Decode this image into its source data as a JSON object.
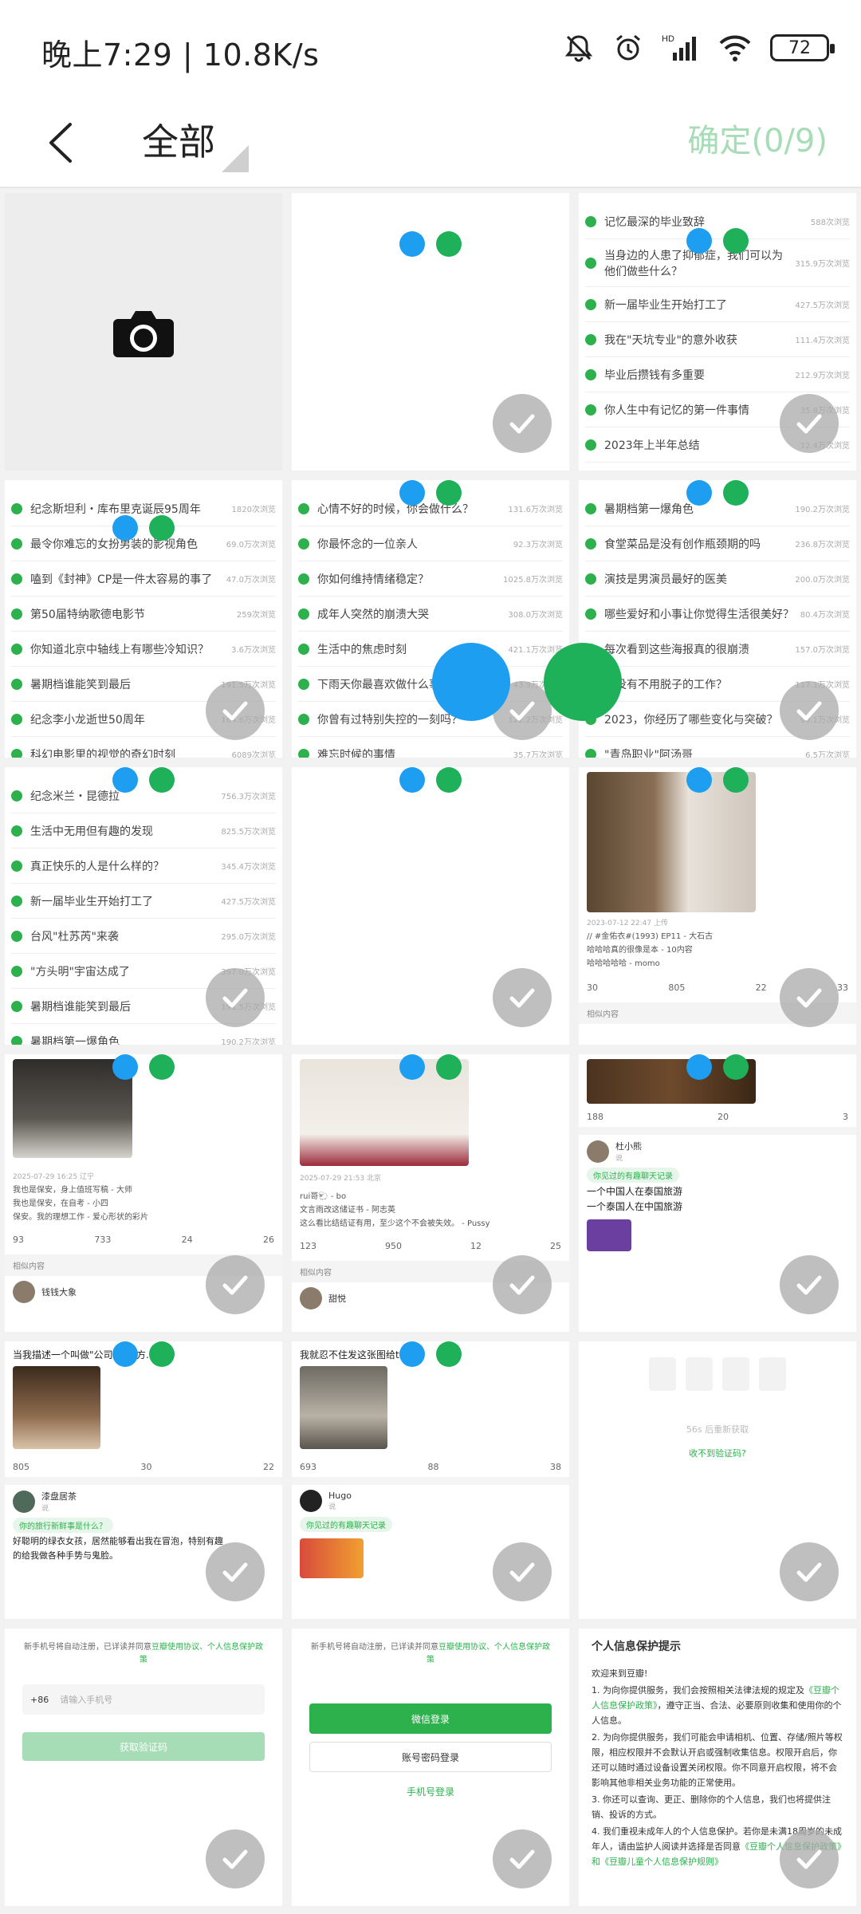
{
  "status": {
    "time": "晚上7:29 | 10.8K/s",
    "battery": "72"
  },
  "header": {
    "title": "全部",
    "confirm": "确定(0/9)"
  },
  "colors": {
    "accent": "#2cb14d",
    "accent_light": "#a6dcb6",
    "dot_blue": "#1e9ef0",
    "dot_green": "#1fb05a"
  },
  "cell1_list": [
    {
      "t": "记忆最深的毕业致辞",
      "n": "588次浏览"
    },
    {
      "t": "当身边的人患了抑郁症，我们可以为他们做些什么？",
      "n": "315.9万次浏览"
    },
    {
      "t": "新一届毕业生开始打工了",
      "n": "427.5万次浏览"
    },
    {
      "t": "我在\"天坑专业\"的意外收获",
      "n": "111.4万次浏览"
    },
    {
      "t": "毕业后攒钱有多重要",
      "n": "212.9万次浏览"
    },
    {
      "t": "你人生中有记忆的第一件事情",
      "n": "35.8万次浏览"
    },
    {
      "t": "2023年上半年总结",
      "n": "12.4万次浏览"
    }
  ],
  "cell3_list": [
    {
      "t": "纪念斯坦利・库布里克诞辰95周年",
      "n": "1820次浏览"
    },
    {
      "t": "最令你难忘的女扮男装的影视角色",
      "n": "69.0万次浏览"
    },
    {
      "t": "嗑到《封神》CP是一件太容易的事了",
      "n": "47.0万次浏览"
    },
    {
      "t": "第50届特纳歌德电影节",
      "n": "259次浏览"
    },
    {
      "t": "你知道北京中轴线上有哪些冷知识？",
      "n": "3.6万次浏览"
    },
    {
      "t": "暑期档谁能笑到最后",
      "n": "191.5万次浏览"
    },
    {
      "t": "纪念李小龙逝世50周年",
      "n": "164.6万次浏览"
    },
    {
      "t": "科幻电影里的视觉的奇幻时刻",
      "n": "6089次浏览"
    }
  ],
  "cell4_list": [
    {
      "t": "心情不好的时候，你会做什么？",
      "n": "131.6万次浏览"
    },
    {
      "t": "你最怀念的一位亲人",
      "n": "92.3万次浏览"
    },
    {
      "t": "你如何维持情绪稳定？",
      "n": "1025.8万次浏览"
    },
    {
      "t": "成年人突然的崩溃大哭",
      "n": "308.0万次浏览"
    },
    {
      "t": "生活中的焦虑时刻",
      "n": "421.1万次浏览"
    },
    {
      "t": "下雨天你最喜欢做什么事",
      "n": "43.9万次浏览"
    },
    {
      "t": "你曾有过特别失控的一刻吗？",
      "n": "122.2万次浏览"
    },
    {
      "t": "难忘时候的事情",
      "n": "35.7万次浏览"
    }
  ],
  "cell5_list": [
    {
      "t": "暑期档第一爆角色",
      "n": "190.2万次浏览"
    },
    {
      "t": "食堂菜品是没有创作瓶颈期的吗",
      "n": "236.8万次浏览"
    },
    {
      "t": "演技是男演员最好的医美",
      "n": "200.0万次浏览"
    },
    {
      "t": "哪些爱好和小事让你觉得生活很美好？",
      "n": "80.4万次浏览"
    },
    {
      "t": "每次看到这些海报真的很崩溃",
      "n": "157.0万次浏览"
    },
    {
      "t": "有没有不用脱子的工作？",
      "n": "117.1万次浏览"
    },
    {
      "t": "2023，你经历了哪些变化与突破？",
      "n": "90.1万次浏览"
    },
    {
      "t": "\"青岛职业\"阿汤哥",
      "n": "6.5万次浏览"
    }
  ],
  "cell6_list": [
    {
      "t": "纪念米兰・昆德拉",
      "n": "756.3万次浏览"
    },
    {
      "t": "生活中无用但有趣的发现",
      "n": "825.5万次浏览"
    },
    {
      "t": "真正快乐的人是什么样的？",
      "n": "345.4万次浏览"
    },
    {
      "t": "新一届毕业生开始打工了",
      "n": "427.5万次浏览"
    },
    {
      "t": "台风\"杜苏芮\"来袭",
      "n": "295.0万次浏览"
    },
    {
      "t": "\"方头明\"宇宙达成了",
      "n": "397.0万次浏览"
    },
    {
      "t": "暑期档谁能笑到最后",
      "n": "191.5万次浏览"
    },
    {
      "t": "暑期档第一爆角色",
      "n": "190.2万次浏览"
    }
  ],
  "cell8": {
    "date": "2023-07-12 22:47 上传",
    "lines": [
      "// #金佑衣#(1993) EP11 - 大石古",
      "哈哈哈真的很像是本 - 10内容",
      "哈哈哈哈哈 - momo"
    ],
    "acts": [
      "30",
      "805",
      "22",
      "33"
    ],
    "sub": "相似内容"
  },
  "cell9": {
    "date": "2025-07-29 16:25 辽宁",
    "lines": [
      "我也是保安，身上值班写稿 - 大师",
      "我也是保安，在自考 - 小四",
      "保安。我的理想工作 - 爱心形状的彩片"
    ],
    "acts": [
      "93",
      "733",
      "24",
      "26"
    ],
    "sub": "相似内容",
    "user": "钱钱大象"
  },
  "cell10": {
    "date": "2025-07-29 21:53 北京",
    "lines": [
      "rui哥🐑 - bo",
      "文言雨改这储证书 - 阿志英",
      "这么看比结结证有用，至少这个不会被失效。 - Pussy"
    ],
    "acts": [
      "123",
      "950",
      "12",
      "25"
    ],
    "sub": "相似内容",
    "user": "甜悦"
  },
  "cell11": {
    "acts": [
      "188",
      "20",
      "3"
    ],
    "user": "杜小熊",
    "user_sub": "说",
    "tag": "你见过的有趣聊天记录",
    "lines": [
      "一个中国人在泰国旅游",
      "一个泰国人在中国旅游"
    ]
  },
  "cell12": {
    "text": "当我描述一个叫做\"公司\"的地方…",
    "acts": [
      "805",
      "30",
      "22"
    ],
    "user": "漆盘居茶",
    "user_sub": "说",
    "tag": "你的旅行新鲜事是什么？",
    "lines": [
      "好聪明的绿衣女孩，居然能够看出我在冒泡，特别有趣",
      "的给我做各种手势与鬼脸。"
    ]
  },
  "cell13": {
    "text": "我就忍不住发这张图给ta😂",
    "acts": [
      "693",
      "88",
      "38"
    ],
    "user": "Hugo",
    "user_sub": "说",
    "tag": "你见过的有趣聊天记录"
  },
  "cell14": {
    "countdown": "56s 后重新获取",
    "link": "收不到验证码?"
  },
  "login": {
    "terms_prefix": "新手机号将自动注册，已详读并同意",
    "terms_link": "豆瓣使用协议、个人信息保护政策",
    "country_code": "+86",
    "phone_placeholder": "请输入手机号",
    "get_code": "获取验证码",
    "wechat_login": "微信登录",
    "password_login": "账号密码登录",
    "phone_login": "手机号登录"
  },
  "privacy": {
    "title": "个人信息保护提示",
    "welcome": "欢迎来到豆瓣!",
    "p1_a": "1. 为向你提供服务，我们会按照相关法律法规的规定及",
    "p1_link": "《豆瓣个人信息保护政策》",
    "p1_b": "，遵守正当、合法、必要原则收集和使用你的个人信息。",
    "p2": "2. 为向你提供服务，我们可能会申请相机、位置、存储/照片等权限，相应权限并不会默认开启或强制收集信息。权限开启后，你还可以随时通过设备设置关闭权限。你不同意开启权限，将不会影响其他非相关业务功能的正常使用。",
    "p3": "3. 你还可以查询、更正、删除你的个人信息，我们也将提供注销、投诉的方式。",
    "p4": "4. 我们重视未成年人的个人信息保护。若你是未满18周岁的未成年人，请由监护人阅读并选择是否同意",
    "p4_link": "《豆瓣个人信息保护政策》和《豆瓣儿童个人信息保护规则》"
  }
}
